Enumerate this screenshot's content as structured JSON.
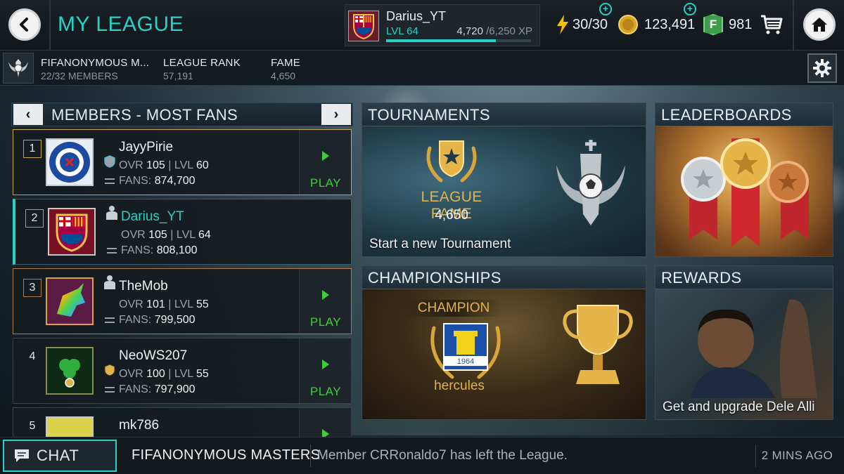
{
  "header": {
    "title": "MY LEAGUE",
    "back_icon": "chevron-left-icon",
    "home_icon": "home-icon"
  },
  "profile": {
    "name": "Darius_YT",
    "level": "LVL 64",
    "xp_current": "4,720",
    "xp_max": "/6,250 XP",
    "xp_progress": 0.755
  },
  "currencies": {
    "energy": "30/30",
    "coins": "123,491",
    "points": "981",
    "points_badge": "F"
  },
  "league": {
    "name": "FIFANONYMOUS M...",
    "members": "22/32 MEMBERS",
    "rank_label": "LEAGUE RANK",
    "rank_value": "57,191",
    "fame_label": "FAME",
    "fame_value": "4,650"
  },
  "members_panel": {
    "title": "MEMBERS - MOST FANS",
    "prev": "‹",
    "next": "›",
    "play_label": "PLAY",
    "ovr_label": "OVR",
    "lvl_label": "LVL",
    "fans_label": "FANS:",
    "rows": [
      {
        "rank": "1",
        "name": "JayyPirie",
        "ovr": "105",
        "lvl": "60",
        "fans": "874,700"
      },
      {
        "rank": "2",
        "name": "Darius_YT",
        "ovr": "105",
        "lvl": "64",
        "fans": "808,100"
      },
      {
        "rank": "3",
        "name": "TheMob",
        "ovr": "101",
        "lvl": "55",
        "fans": "799,500"
      },
      {
        "rank": "4",
        "name": "NeoWS207",
        "ovr": "100",
        "lvl": "55",
        "fans": "797,900"
      },
      {
        "rank": "5",
        "name": "mk786"
      }
    ]
  },
  "tiles": {
    "tournaments": {
      "title": "TOURNAMENTS",
      "fame_label": "LEAGUE FAME",
      "fame_value": "4,650",
      "caption": "Start a new Tournament"
    },
    "leaderboards": {
      "title": "LEADERBOARDS"
    },
    "championships": {
      "title": "CHAMPIONSHIPS",
      "champion_label": "CHAMPION",
      "club_name": "hercules",
      "crest_year": "1964"
    },
    "rewards": {
      "title": "REWARDS",
      "caption": "Get and upgrade Dele Alli"
    }
  },
  "chat": {
    "button_label": "CHAT",
    "league_name": "FIFANONYMOUS MASTERS",
    "message": "Member CRRonaldo7 has left the League.",
    "time": "2 MINS AGO"
  },
  "colors": {
    "accent": "#28d0c5",
    "play_green": "#3ecf3a",
    "gold": "#e2b34c"
  }
}
